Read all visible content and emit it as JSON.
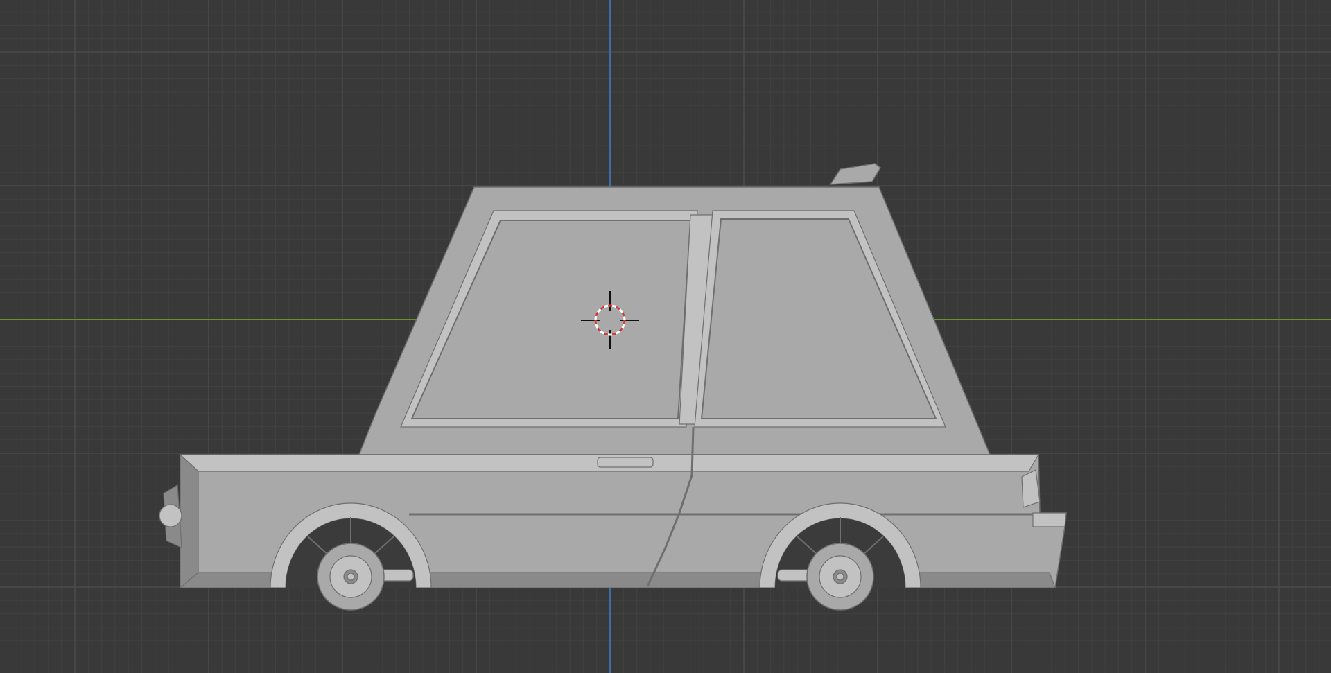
{
  "viewport": {
    "background": "#393939",
    "grid_minor_color": "#414141",
    "grid_major_color": "#4a4a4a",
    "x_axis_color": "#6b8f2c",
    "y_axis_color": "#3a6ea5"
  },
  "model": {
    "body_color": "#a9a9a9",
    "body_light": "#c2c2c2",
    "body_dark": "#8a8a8a",
    "edge_color": "#6f6f6f"
  },
  "cursor": {
    "ring_color": "#d23a3a",
    "ring_color_alt": "#ffffff",
    "cross_color": "#111111"
  },
  "icons": {
    "cursor": "3d-cursor-icon"
  }
}
